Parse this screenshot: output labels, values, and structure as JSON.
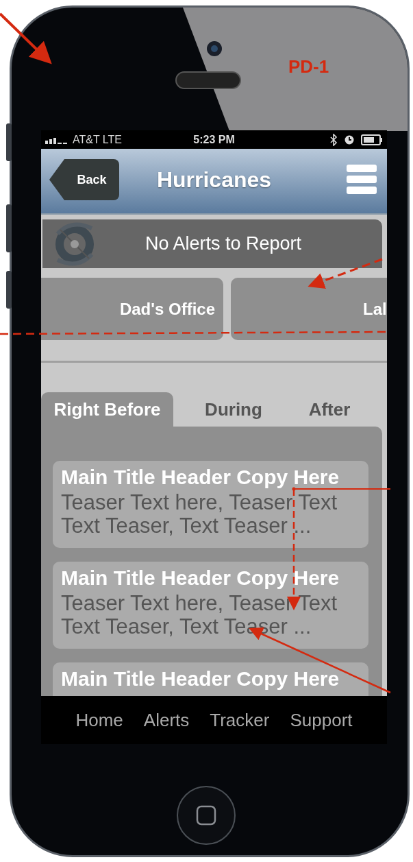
{
  "annotation": {
    "label": "PD-1"
  },
  "status_bar": {
    "carrier": "AT&T LTE",
    "time": "5:23 PM"
  },
  "nav_bar": {
    "back": "Back",
    "title": "Hurricanes"
  },
  "alert": {
    "text": "No Alerts to Report"
  },
  "locations": [
    "Dad's Office",
    "Lal"
  ],
  "tabs": [
    {
      "label": "Right Before",
      "selected": true
    },
    {
      "label": "During",
      "selected": false
    },
    {
      "label": "After",
      "selected": false
    }
  ],
  "articles": [
    {
      "title": "Main Title Header Copy Here",
      "teaser": "Teaser Text here, Teaser Text Text Teaser, Text Teaser ..."
    },
    {
      "title": "Main Title Header Copy Here",
      "teaser": "Teaser Text here, Teaser Text Text Teaser, Text Teaser ..."
    },
    {
      "title": "Main Title Header Copy Here"
    }
  ],
  "tab_bar": [
    "Home",
    "Alerts",
    "Tracker",
    "Support"
  ]
}
